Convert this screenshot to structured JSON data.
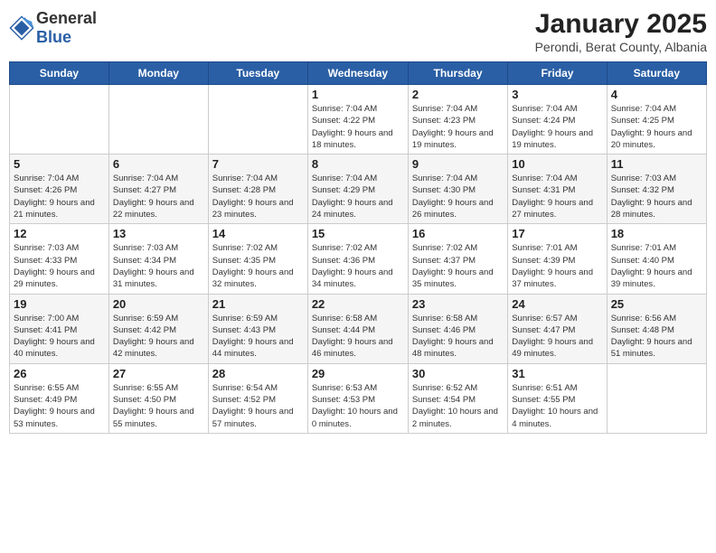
{
  "header": {
    "logo_general": "General",
    "logo_blue": "Blue",
    "month": "January 2025",
    "location": "Perondi, Berat County, Albania"
  },
  "days_of_week": [
    "Sunday",
    "Monday",
    "Tuesday",
    "Wednesday",
    "Thursday",
    "Friday",
    "Saturday"
  ],
  "weeks": [
    [
      {
        "day": "",
        "info": ""
      },
      {
        "day": "",
        "info": ""
      },
      {
        "day": "",
        "info": ""
      },
      {
        "day": "1",
        "info": "Sunrise: 7:04 AM\nSunset: 4:22 PM\nDaylight: 9 hours and 18 minutes."
      },
      {
        "day": "2",
        "info": "Sunrise: 7:04 AM\nSunset: 4:23 PM\nDaylight: 9 hours and 19 minutes."
      },
      {
        "day": "3",
        "info": "Sunrise: 7:04 AM\nSunset: 4:24 PM\nDaylight: 9 hours and 19 minutes."
      },
      {
        "day": "4",
        "info": "Sunrise: 7:04 AM\nSunset: 4:25 PM\nDaylight: 9 hours and 20 minutes."
      }
    ],
    [
      {
        "day": "5",
        "info": "Sunrise: 7:04 AM\nSunset: 4:26 PM\nDaylight: 9 hours and 21 minutes."
      },
      {
        "day": "6",
        "info": "Sunrise: 7:04 AM\nSunset: 4:27 PM\nDaylight: 9 hours and 22 minutes."
      },
      {
        "day": "7",
        "info": "Sunrise: 7:04 AM\nSunset: 4:28 PM\nDaylight: 9 hours and 23 minutes."
      },
      {
        "day": "8",
        "info": "Sunrise: 7:04 AM\nSunset: 4:29 PM\nDaylight: 9 hours and 24 minutes."
      },
      {
        "day": "9",
        "info": "Sunrise: 7:04 AM\nSunset: 4:30 PM\nDaylight: 9 hours and 26 minutes."
      },
      {
        "day": "10",
        "info": "Sunrise: 7:04 AM\nSunset: 4:31 PM\nDaylight: 9 hours and 27 minutes."
      },
      {
        "day": "11",
        "info": "Sunrise: 7:03 AM\nSunset: 4:32 PM\nDaylight: 9 hours and 28 minutes."
      }
    ],
    [
      {
        "day": "12",
        "info": "Sunrise: 7:03 AM\nSunset: 4:33 PM\nDaylight: 9 hours and 29 minutes."
      },
      {
        "day": "13",
        "info": "Sunrise: 7:03 AM\nSunset: 4:34 PM\nDaylight: 9 hours and 31 minutes."
      },
      {
        "day": "14",
        "info": "Sunrise: 7:02 AM\nSunset: 4:35 PM\nDaylight: 9 hours and 32 minutes."
      },
      {
        "day": "15",
        "info": "Sunrise: 7:02 AM\nSunset: 4:36 PM\nDaylight: 9 hours and 34 minutes."
      },
      {
        "day": "16",
        "info": "Sunrise: 7:02 AM\nSunset: 4:37 PM\nDaylight: 9 hours and 35 minutes."
      },
      {
        "day": "17",
        "info": "Sunrise: 7:01 AM\nSunset: 4:39 PM\nDaylight: 9 hours and 37 minutes."
      },
      {
        "day": "18",
        "info": "Sunrise: 7:01 AM\nSunset: 4:40 PM\nDaylight: 9 hours and 39 minutes."
      }
    ],
    [
      {
        "day": "19",
        "info": "Sunrise: 7:00 AM\nSunset: 4:41 PM\nDaylight: 9 hours and 40 minutes."
      },
      {
        "day": "20",
        "info": "Sunrise: 6:59 AM\nSunset: 4:42 PM\nDaylight: 9 hours and 42 minutes."
      },
      {
        "day": "21",
        "info": "Sunrise: 6:59 AM\nSunset: 4:43 PM\nDaylight: 9 hours and 44 minutes."
      },
      {
        "day": "22",
        "info": "Sunrise: 6:58 AM\nSunset: 4:44 PM\nDaylight: 9 hours and 46 minutes."
      },
      {
        "day": "23",
        "info": "Sunrise: 6:58 AM\nSunset: 4:46 PM\nDaylight: 9 hours and 48 minutes."
      },
      {
        "day": "24",
        "info": "Sunrise: 6:57 AM\nSunset: 4:47 PM\nDaylight: 9 hours and 49 minutes."
      },
      {
        "day": "25",
        "info": "Sunrise: 6:56 AM\nSunset: 4:48 PM\nDaylight: 9 hours and 51 minutes."
      }
    ],
    [
      {
        "day": "26",
        "info": "Sunrise: 6:55 AM\nSunset: 4:49 PM\nDaylight: 9 hours and 53 minutes."
      },
      {
        "day": "27",
        "info": "Sunrise: 6:55 AM\nSunset: 4:50 PM\nDaylight: 9 hours and 55 minutes."
      },
      {
        "day": "28",
        "info": "Sunrise: 6:54 AM\nSunset: 4:52 PM\nDaylight: 9 hours and 57 minutes."
      },
      {
        "day": "29",
        "info": "Sunrise: 6:53 AM\nSunset: 4:53 PM\nDaylight: 10 hours and 0 minutes."
      },
      {
        "day": "30",
        "info": "Sunrise: 6:52 AM\nSunset: 4:54 PM\nDaylight: 10 hours and 2 minutes."
      },
      {
        "day": "31",
        "info": "Sunrise: 6:51 AM\nSunset: 4:55 PM\nDaylight: 10 hours and 4 minutes."
      },
      {
        "day": "",
        "info": ""
      }
    ]
  ]
}
